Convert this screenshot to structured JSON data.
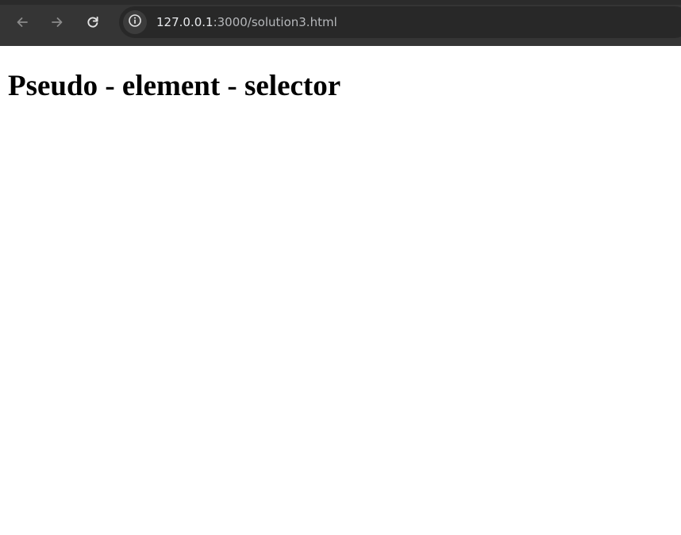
{
  "browser": {
    "nav_buttons": {
      "back_icon": "arrow-left",
      "forward_icon": "arrow-right",
      "reload_icon": "reload"
    },
    "address_bar": {
      "site_info_icon": "info",
      "url_host": "127.0.0.1",
      "url_rest": ":3000/solution3.html"
    }
  },
  "page": {
    "heading": "Pseudo - element - selector"
  },
  "colors": {
    "toolbar_bg": "#353535",
    "omnibox_bg": "#282828",
    "page_bg": "#ffffff",
    "heading_text": "#000000"
  }
}
